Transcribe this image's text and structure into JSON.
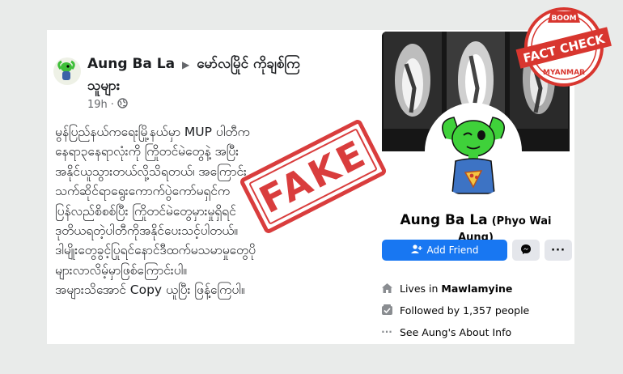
{
  "post": {
    "author": "Aung Ba La",
    "group": "မော်လမြိုင် ကိုချစ်ကြ",
    "group_line2": "သူများ",
    "time": "19h",
    "body_lines": [
      "မွန်ပြည်နယ်ကရေးမြို့နယ်မှာ MUP ပါတီက",
      "နေရာ၃နေရာလုံးကို ကြိုတင်မဲတွေနဲ့ အပြီး",
      "အနိုင်ယူသွားတယ်လို့သိရတယ်၊ အကြောင်း",
      "သက်ဆိုင်ရာရွေးကောက်ပွဲကော်မရှင်က",
      "ပြန်လည်စိစစ်ပြီး ကြိုတင်မဲတွေမှားမှုရှိရင်",
      "ဒုတိယရတဲ့ပါတီကိုအနိုင်ပေးသင့်ပါတယ်။",
      "ဒါမျိုးတွေခွင့်ပြုရင်နောင်ဒီထက်မသမာမှုတွေပို",
      "များလာလိမ့်မှာဖြစ်ကြောင်းပါ။",
      "အများသိအောင် Copy ယူပြီး ဖြန့်ကြေပါ။"
    ]
  },
  "stamp": {
    "text": "FAKE"
  },
  "profile": {
    "name": "Aung Ba La",
    "alt_name": "(Phyo Wai Aung)",
    "add_friend_label": "Add Friend",
    "lives_prefix": "Lives in",
    "lives_city": "Mawlamyine",
    "followed_by": "Followed by 1,357 people",
    "about_link": "See Aung's About Info"
  },
  "badge": {
    "top": "BOOM",
    "middle": "FACT CHECK",
    "bottom": "MYANMAR"
  },
  "colors": {
    "stamp_red": "#d62d2d",
    "facebook_blue": "#1877f2",
    "badge_red": "#d8362f"
  }
}
